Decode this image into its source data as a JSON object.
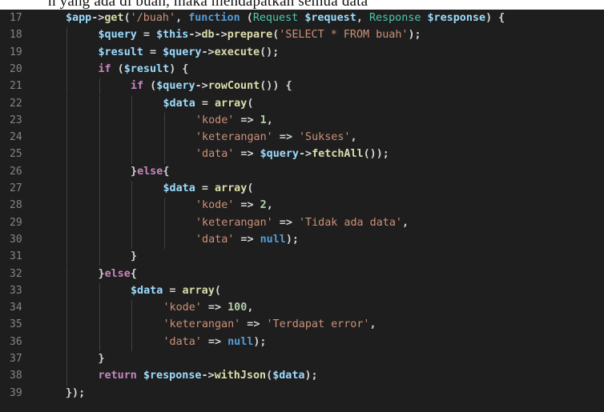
{
  "doc_text_fragment": "n yang ada di buah, maka mendapatkan semua data",
  "editor": {
    "lines": [
      {
        "n": "17",
        "indent": 1,
        "tokens": [
          [
            "var",
            "$app"
          ],
          [
            "op",
            "->"
          ],
          [
            "fn",
            "get"
          ],
          [
            "punc",
            "("
          ],
          [
            "str",
            "'/buah'"
          ],
          [
            "punc",
            ", "
          ],
          [
            "kw2",
            "function"
          ],
          [
            "punc",
            " ("
          ],
          [
            "type",
            "Request"
          ],
          [
            "punc",
            " "
          ],
          [
            "var",
            "$request"
          ],
          [
            "punc",
            ", "
          ],
          [
            "type",
            "Response"
          ],
          [
            "punc",
            " "
          ],
          [
            "var",
            "$response"
          ],
          [
            "punc",
            ") {"
          ]
        ]
      },
      {
        "n": "18",
        "indent": 2,
        "tokens": [
          [
            "var",
            "$query"
          ],
          [
            "op",
            " = "
          ],
          [
            "var",
            "$this"
          ],
          [
            "op",
            "->"
          ],
          [
            "fn",
            "db"
          ],
          [
            "op",
            "->"
          ],
          [
            "fn",
            "prepare"
          ],
          [
            "punc",
            "("
          ],
          [
            "str",
            "'SELECT * FROM buah'"
          ],
          [
            "punc",
            ");"
          ]
        ]
      },
      {
        "n": "19",
        "indent": 2,
        "tokens": [
          [
            "var",
            "$result"
          ],
          [
            "op",
            " = "
          ],
          [
            "var",
            "$query"
          ],
          [
            "op",
            "->"
          ],
          [
            "fn",
            "execute"
          ],
          [
            "punc",
            "();"
          ]
        ]
      },
      {
        "n": "20",
        "indent": 2,
        "tokens": [
          [
            "kw",
            "if"
          ],
          [
            "punc",
            " ("
          ],
          [
            "var",
            "$result"
          ],
          [
            "punc",
            ") {"
          ]
        ]
      },
      {
        "n": "21",
        "indent": 3,
        "tokens": [
          [
            "kw",
            "if"
          ],
          [
            "punc",
            " ("
          ],
          [
            "var",
            "$query"
          ],
          [
            "op",
            "->"
          ],
          [
            "fn",
            "rowCount"
          ],
          [
            "punc",
            "()) {"
          ]
        ]
      },
      {
        "n": "22",
        "indent": 4,
        "tokens": [
          [
            "var",
            "$data"
          ],
          [
            "op",
            " = "
          ],
          [
            "fn",
            "array"
          ],
          [
            "punc",
            "("
          ]
        ]
      },
      {
        "n": "23",
        "indent": 5,
        "tokens": [
          [
            "str",
            "'kode'"
          ],
          [
            "op",
            " => "
          ],
          [
            "num",
            "1"
          ],
          [
            "punc",
            ","
          ]
        ]
      },
      {
        "n": "24",
        "indent": 5,
        "tokens": [
          [
            "str",
            "'keterangan'"
          ],
          [
            "op",
            " => "
          ],
          [
            "str",
            "'Sukses'"
          ],
          [
            "punc",
            ","
          ]
        ]
      },
      {
        "n": "25",
        "indent": 5,
        "tokens": [
          [
            "str",
            "'data'"
          ],
          [
            "op",
            " => "
          ],
          [
            "var",
            "$query"
          ],
          [
            "op",
            "->"
          ],
          [
            "fn",
            "fetchAll"
          ],
          [
            "punc",
            "());"
          ]
        ]
      },
      {
        "n": "26",
        "indent": 3,
        "tokens": [
          [
            "punc",
            "}"
          ],
          [
            "kw",
            "else"
          ],
          [
            "punc",
            "{"
          ]
        ]
      },
      {
        "n": "27",
        "indent": 4,
        "tokens": [
          [
            "var",
            "$data"
          ],
          [
            "op",
            " = "
          ],
          [
            "fn",
            "array"
          ],
          [
            "punc",
            "("
          ]
        ]
      },
      {
        "n": "28",
        "indent": 5,
        "tokens": [
          [
            "str",
            "'kode'"
          ],
          [
            "op",
            " => "
          ],
          [
            "num",
            "2"
          ],
          [
            "punc",
            ","
          ]
        ]
      },
      {
        "n": "29",
        "indent": 5,
        "tokens": [
          [
            "str",
            "'keterangan'"
          ],
          [
            "op",
            " => "
          ],
          [
            "str",
            "'Tidak ada data'"
          ],
          [
            "punc",
            ","
          ]
        ]
      },
      {
        "n": "30",
        "indent": 5,
        "tokens": [
          [
            "str",
            "'data'"
          ],
          [
            "op",
            " => "
          ],
          [
            "kw2",
            "null"
          ],
          [
            "punc",
            ");"
          ]
        ]
      },
      {
        "n": "31",
        "indent": 3,
        "tokens": [
          [
            "punc",
            "}"
          ]
        ]
      },
      {
        "n": "32",
        "indent": 2,
        "tokens": [
          [
            "punc",
            "}"
          ],
          [
            "kw",
            "else"
          ],
          [
            "punc",
            "{"
          ]
        ]
      },
      {
        "n": "33",
        "indent": 3,
        "tokens": [
          [
            "var",
            "$data"
          ],
          [
            "op",
            " = "
          ],
          [
            "fn",
            "array"
          ],
          [
            "punc",
            "("
          ]
        ]
      },
      {
        "n": "34",
        "indent": 4,
        "tokens": [
          [
            "str",
            "'kode'"
          ],
          [
            "op",
            " => "
          ],
          [
            "num",
            "100"
          ],
          [
            "punc",
            ","
          ]
        ]
      },
      {
        "n": "35",
        "indent": 4,
        "tokens": [
          [
            "str",
            "'keterangan'"
          ],
          [
            "op",
            " => "
          ],
          [
            "str",
            "'Terdapat error'"
          ],
          [
            "punc",
            ","
          ]
        ]
      },
      {
        "n": "36",
        "indent": 4,
        "tokens": [
          [
            "str",
            "'data'"
          ],
          [
            "op",
            " => "
          ],
          [
            "kw2",
            "null"
          ],
          [
            "punc",
            ");"
          ]
        ]
      },
      {
        "n": "37",
        "indent": 2,
        "tokens": [
          [
            "punc",
            "}"
          ]
        ]
      },
      {
        "n": "38",
        "indent": 2,
        "tokens": [
          [
            "kw",
            "return"
          ],
          [
            "punc",
            " "
          ],
          [
            "var",
            "$response"
          ],
          [
            "op",
            "->"
          ],
          [
            "fn",
            "withJson"
          ],
          [
            "punc",
            "("
          ],
          [
            "var",
            "$data"
          ],
          [
            "punc",
            ");"
          ]
        ]
      },
      {
        "n": "39",
        "indent": 1,
        "tokens": [
          [
            "punc",
            "});"
          ]
        ]
      }
    ],
    "colors": {
      "background": "#1e1e1e",
      "line_number": "#858585",
      "variable": "#9cdcfe",
      "function": "#dcdcaa",
      "keyword": "#c586c0",
      "keyword_storage": "#569cd6",
      "string": "#ce9178",
      "number": "#b5cea8",
      "type": "#4ec9b0",
      "punctuation": "#d4d4d4"
    }
  }
}
